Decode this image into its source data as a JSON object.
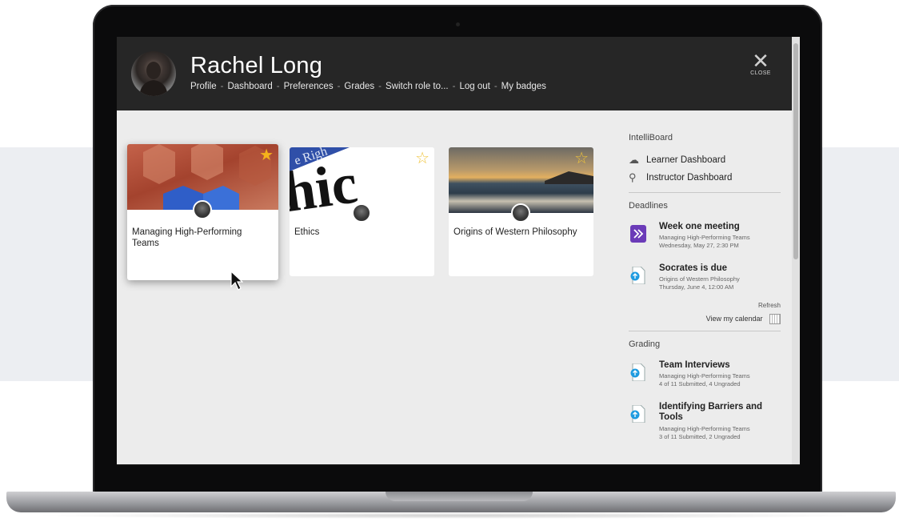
{
  "header": {
    "user_name": "Rachel Long",
    "nav": [
      "Profile",
      "Dashboard",
      "Preferences",
      "Grades",
      "Switch role to...",
      "Log out",
      "My badges"
    ],
    "close_label": "CLOSE"
  },
  "courses": [
    {
      "title": "Managing High-Performing Teams",
      "starred": true
    },
    {
      "title": "Ethics",
      "starred": false
    },
    {
      "title": "Origins of Western Philosophy",
      "starred": false
    }
  ],
  "sidebar": {
    "intelliboard": {
      "title": "IntelliBoard",
      "links": [
        "Learner Dashboard",
        "Instructor Dashboard"
      ]
    },
    "deadlines": {
      "title": "Deadlines",
      "items": [
        {
          "title": "Week one meeting",
          "course": "Managing High-Performing Teams",
          "date": "Wednesday, May 27, 2:30 PM",
          "icon": "meeting-icon"
        },
        {
          "title": "Socrates is due",
          "course": "Origins of Western Philosophy",
          "date": "Thursday, June 4, 12:00 AM",
          "icon": "assignment-icon"
        }
      ],
      "refresh": "Refresh",
      "calendar": "View my calendar"
    },
    "grading": {
      "title": "Grading",
      "items": [
        {
          "title": "Team Interviews",
          "course": "Managing High-Performing Teams",
          "status": "4 of 11 Submitted, 4 Ungraded"
        },
        {
          "title": "Identifying Barriers and Tools",
          "course": "Managing High-Performing Teams",
          "status": "3 of 11 Submitted, 2 Ungraded"
        }
      ]
    }
  },
  "colors": {
    "header_bg": "#262626",
    "star_filled": "#f5b21b",
    "star_empty": "#f0c43a",
    "meeting_icon": "#6b3bb8",
    "assignment_icon": "#1e9be0"
  }
}
